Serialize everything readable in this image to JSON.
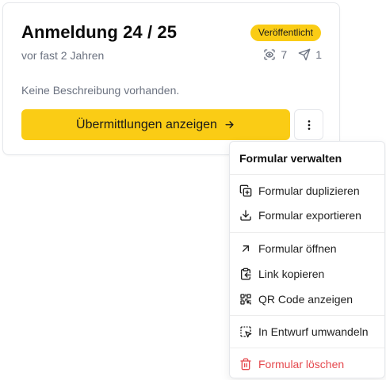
{
  "card": {
    "title": "Anmeldung 24 / 25",
    "status_badge": "Veröffentlicht",
    "subtitle": "vor fast 2 Jahren",
    "views_count": "7",
    "submissions_sent_count": "1",
    "description": "Keine Beschreibung vorhanden.",
    "primary_button_label": "Übermittlungen anzeigen",
    "icons": {
      "views": "eye-icon",
      "sent": "send-icon",
      "primary_arrow": "arrow-right-icon",
      "more": "more-vertical-icon"
    }
  },
  "menu": {
    "header": "Formular verwalten",
    "items": [
      {
        "label": "Formular duplizieren",
        "icon": "copy-plus-icon"
      },
      {
        "label": "Formular exportieren",
        "icon": "download-icon"
      },
      {
        "label": "Formular öffnen",
        "icon": "arrow-up-right-icon"
      },
      {
        "label": "Link kopieren",
        "icon": "clipboard-copy-icon"
      },
      {
        "label": "QR Code anzeigen",
        "icon": "qr-code-icon"
      },
      {
        "label": "In Entwurf umwandeln",
        "icon": "square-dashed-pointer-icon"
      },
      {
        "label": "Formular löschen",
        "icon": "trash-icon"
      }
    ]
  },
  "colors": {
    "accent_yellow": "#facc15",
    "danger_red": "#e5484d",
    "muted_text": "#6b7280",
    "border": "#e5e7eb"
  }
}
